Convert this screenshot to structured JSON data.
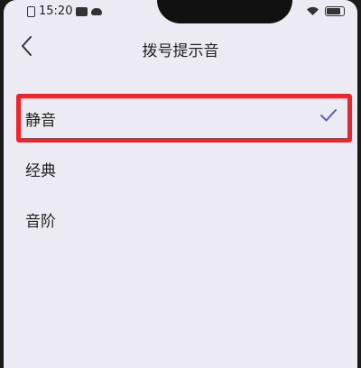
{
  "status_bar": {
    "time": "15:20",
    "icons": [
      "sim-icon",
      "mail-icon",
      "cloud-icon",
      "wifi-icon",
      "battery-icon"
    ]
  },
  "header": {
    "title": "拨号提示音",
    "back_icon": "chevron-left-icon"
  },
  "options": [
    {
      "label": "静音",
      "selected": true
    },
    {
      "label": "经典",
      "selected": false
    },
    {
      "label": "音阶",
      "selected": false
    }
  ],
  "colors": {
    "background": "#ecebf3",
    "check": "#5a5ad0",
    "highlight": "#f2222a"
  }
}
